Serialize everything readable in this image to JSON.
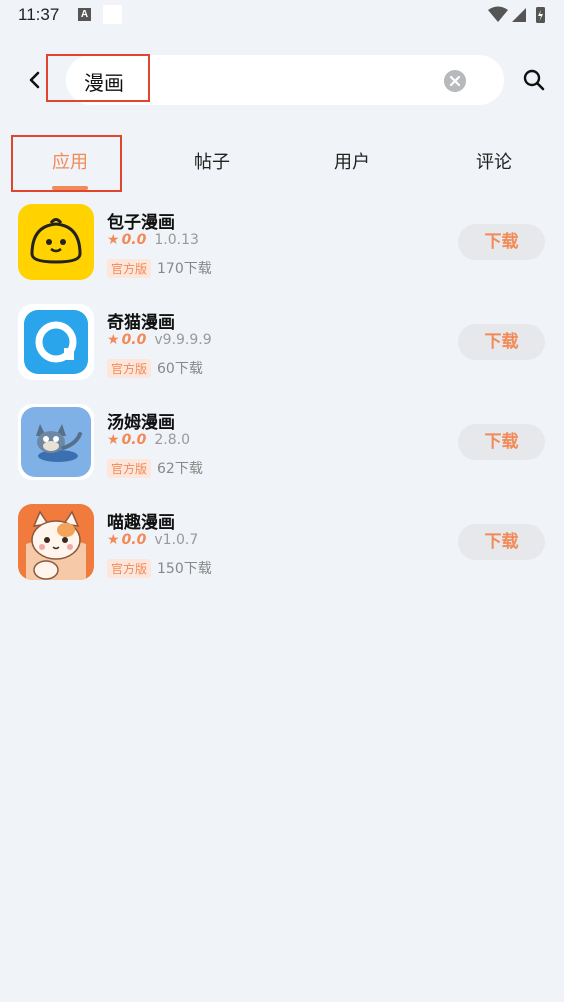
{
  "status_bar": {
    "time": "11:37",
    "a_badge": "A"
  },
  "search": {
    "query": "漫画"
  },
  "tabs": [
    {
      "label": "应用",
      "active": true
    },
    {
      "label": "帖子",
      "active": false
    },
    {
      "label": "用户",
      "active": false
    },
    {
      "label": "评论",
      "active": false
    }
  ],
  "apps": [
    {
      "name": "包子漫画",
      "rating": "0.0",
      "version": "1.0.13",
      "badge": "官方版",
      "downloads": "170下载",
      "download_label": "下载",
      "icon": "baozi-app-icon"
    },
    {
      "name": "奇猫漫画",
      "rating": "0.0",
      "version": "v9.9.9.9",
      "badge": "官方版",
      "downloads": "60下载",
      "download_label": "下载",
      "icon": "qimao-app-icon"
    },
    {
      "name": "汤姆漫画",
      "rating": "0.0",
      "version": "2.8.0",
      "badge": "官方版",
      "downloads": "62下载",
      "download_label": "下载",
      "icon": "tom-app-icon"
    },
    {
      "name": "喵趣漫画",
      "rating": "0.0",
      "version": "v1.0.7",
      "badge": "官方版",
      "downloads": "150下载",
      "download_label": "下载",
      "icon": "miaoqu-app-icon"
    }
  ],
  "colors": {
    "accent": "#f28a57",
    "background": "#f0f3f7",
    "highlight_box": "#e0462d"
  }
}
